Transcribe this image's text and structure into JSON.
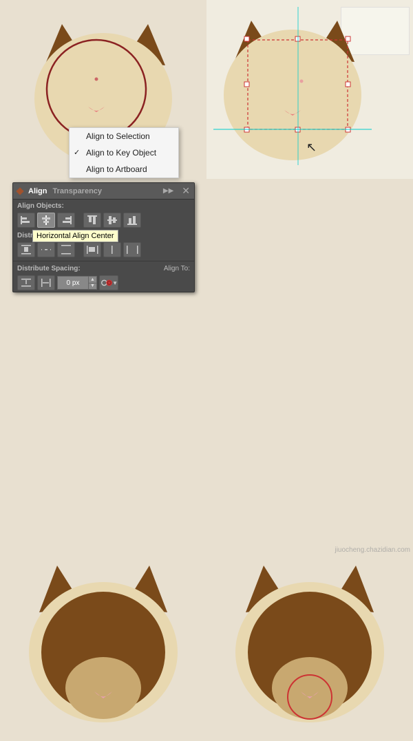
{
  "panel": {
    "title": "Align",
    "tab2": "Transparency",
    "sections": {
      "alignObjects": "Align Objects:",
      "distributeObjects": "Distribute Objects:",
      "distributeSpacing": "Distribute Spacing:",
      "alignTo": "Align To:"
    },
    "spacingValue": "0 px",
    "tooltip": "Horizontal Align Center",
    "buttons": {
      "alignLeft": "align-left",
      "alignHCenter": "align-h-center",
      "alignRight": "align-right",
      "alignTop": "align-top",
      "alignVCenter": "align-v-center",
      "alignBottom": "align-bottom"
    }
  },
  "dropdown": {
    "items": [
      {
        "label": "Align to Selection",
        "checked": false
      },
      {
        "label": "Align to Key Object",
        "checked": true
      },
      {
        "label": "Align to Artboard",
        "checked": false
      }
    ]
  },
  "watermark": "jiuocheng.chazidian.com"
}
